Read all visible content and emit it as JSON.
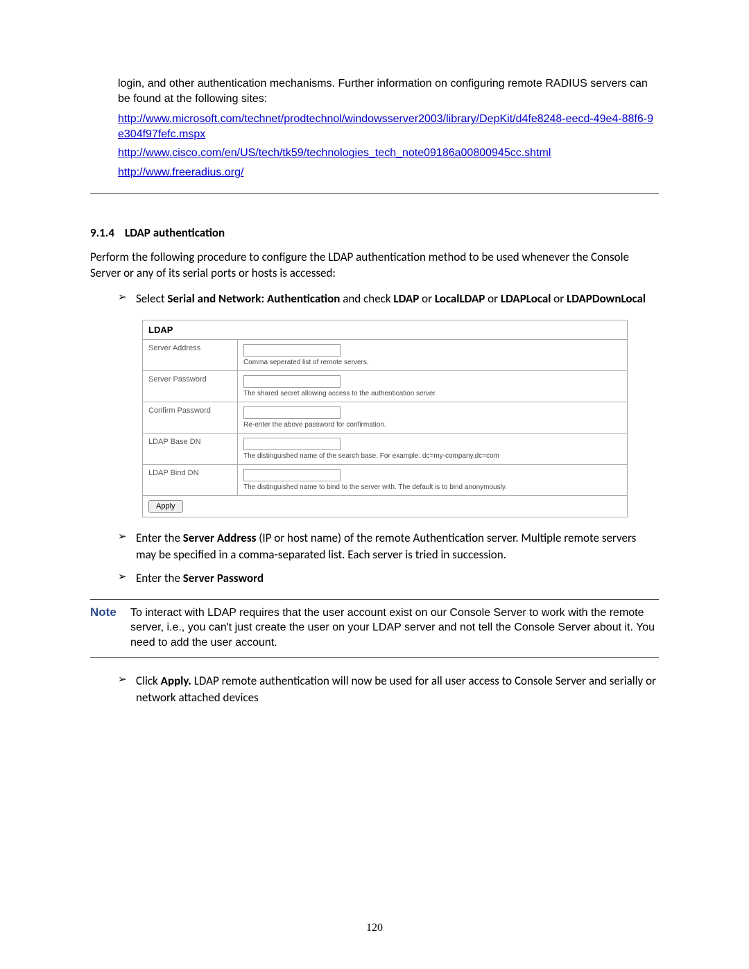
{
  "intro": {
    "p1": "login, and other authentication mechanisms. Further information on configuring remote RADIUS servers can be found at the following sites:",
    "links": [
      "http://www.microsoft.com/technet/prodtechnol/windowsserver2003/library/DepKit/d4fe8248-eecd-49e4-88f6-9e304f97fefc.mspx",
      "http://www.cisco.com/en/US/tech/tk59/technologies_tech_note09186a00800945cc.shtml",
      "http://www.freeradius.org/"
    ]
  },
  "section": {
    "number": "9.1.4",
    "title": "LDAP authentication"
  },
  "perform_text": "Perform the following procedure to configure the LDAP authentication method to be used whenever the Console Server or any of its serial ports or hosts is accessed:",
  "bullet1": {
    "pre": "Select ",
    "bold1": "Serial and Network: Authentication",
    "mid": " and check  ",
    "b_ldap": "LDAP",
    "or1": " or ",
    "b_local": "LocalLDAP",
    "or2": " or ",
    "b_ldaplocal": "LDAPLocal",
    "or3": " or ",
    "b_down": "LDAPDownLocal"
  },
  "ldap_form": {
    "title": "LDAP",
    "apply_label": "Apply",
    "rows": [
      {
        "label": "Server Address",
        "desc": "Comma seperated list of remote servers."
      },
      {
        "label": "Server Password",
        "desc": "The shared secret allowing access to the authentication server."
      },
      {
        "label": "Confirm Password",
        "desc": "Re-enter the above password for confirmation."
      },
      {
        "label": "LDAP Base DN",
        "desc": "The distinguished name of the search base. For example: dc=my-company,dc=com"
      },
      {
        "label": "LDAP Bind DN",
        "desc": "The distinguished name to bind to the server with. The default is to bind anonymously."
      }
    ]
  },
  "bullet2": {
    "pre": "Enter the ",
    "bold": "Server Address",
    "post": " (IP or host name) of the remote Authentication server. Multiple remote servers may be specified in a comma-separated list. Each server is tried in succession."
  },
  "bullet3": {
    "pre": "Enter the ",
    "bold": "Server Password"
  },
  "note": {
    "label": "Note",
    "text": "To interact with LDAP requires that the user account exist on our Console Server to work with the remote server, i.e., you can't just create the user on your LDAP server and not tell the Console Server about it. You need to add the user account."
  },
  "bullet4": {
    "pre": "Click ",
    "bold": "Apply.",
    "post": " LDAP remote authentication will now be used for all user access to Console Server and serially or network attached devices"
  },
  "page_number": "120"
}
